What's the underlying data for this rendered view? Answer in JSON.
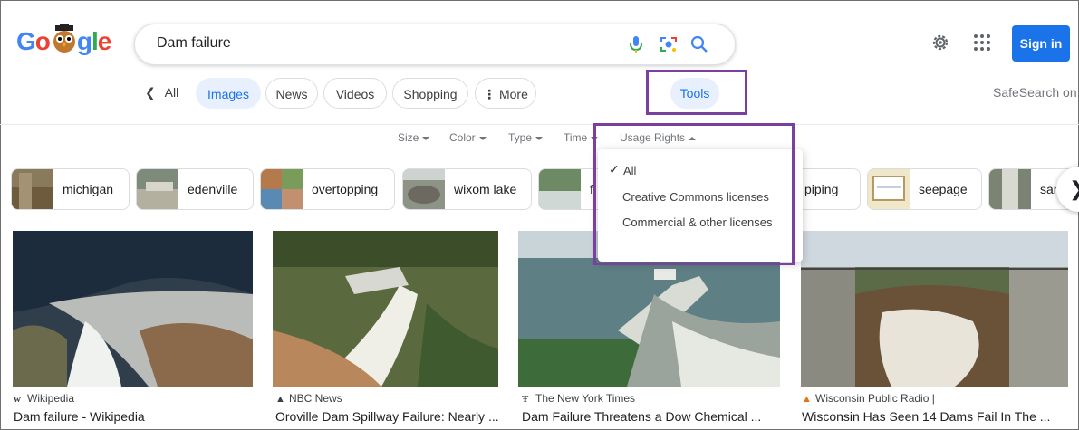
{
  "header": {
    "logo_text": "Google",
    "query": "Dam failure",
    "sign_in": "Sign in"
  },
  "nav": {
    "back_all": "All",
    "tabs": [
      "Images",
      "News",
      "Videos",
      "Shopping",
      "More"
    ],
    "more_prefix": "⋮",
    "tools": "Tools",
    "safesearch": "SafeSearch on"
  },
  "filters": [
    "Size",
    "Color",
    "Type",
    "Time",
    "Usage Rights"
  ],
  "suggestions": [
    "michigan",
    "edenville",
    "overtopping",
    "wixom lake",
    "f",
    "piping",
    "seepage",
    "san"
  ],
  "dropdown": {
    "items": [
      "All",
      "Creative Commons licenses",
      "Commercial & other licenses"
    ],
    "selected": "All"
  },
  "results": [
    {
      "source": "Wikipedia",
      "source_icon": "W",
      "title": "Dam failure - Wikipedia"
    },
    {
      "source": "NBC News",
      "source_icon": "NBC",
      "title": "Oroville Dam Spillway Failure: Nearly ..."
    },
    {
      "source": "The New York Times",
      "source_icon": "T",
      "title": "Dam Failure Threatens a Dow Chemical ..."
    },
    {
      "source": "Wisconsin Public Radio |",
      "source_icon": "WPR",
      "title": "Wisconsin Has Seen 14 Dams Fail In The ..."
    }
  ],
  "colors": {
    "accent": "#1a73e8",
    "annotation": "#7b3fa0"
  }
}
